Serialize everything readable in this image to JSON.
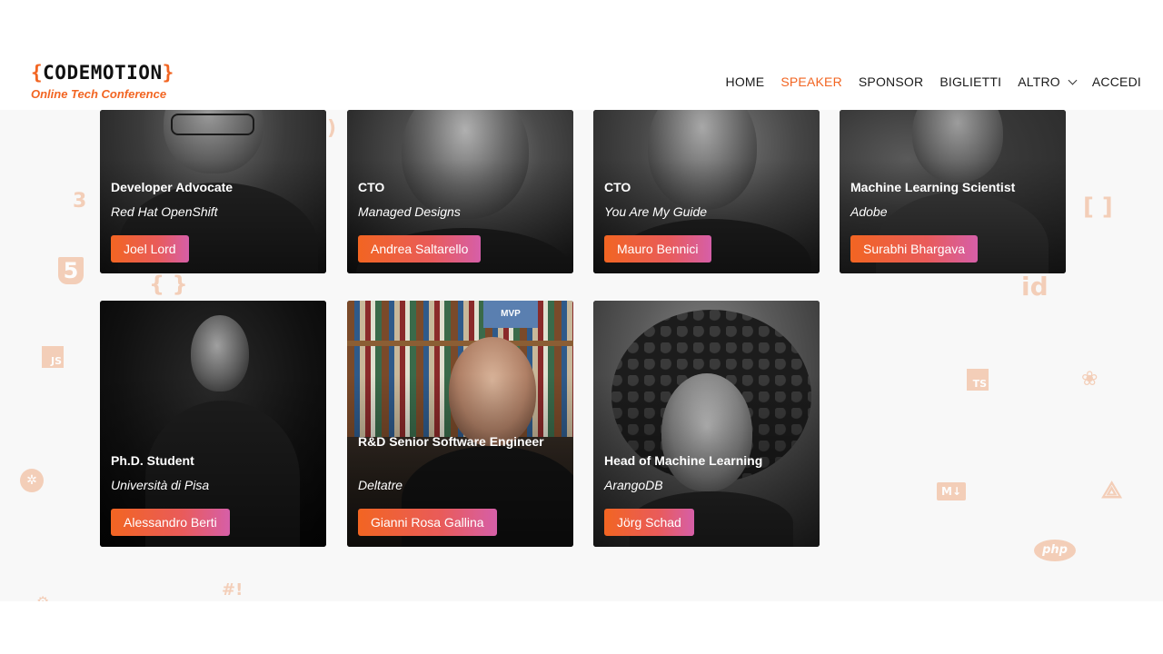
{
  "header": {
    "logo_open_brace": "{",
    "logo_word": "CODEMOTION",
    "logo_close_brace": "}",
    "logo_tagline": "Online Tech Conference",
    "nav": {
      "home": "HOME",
      "speaker": "SPEAKER",
      "sponsor": "SPONSOR",
      "biglietti": "BIGLIETTI",
      "altro": "ALTRO",
      "accedi": "ACCEDI"
    },
    "active_nav": "SPEAKER",
    "accent_color": "#f26522"
  },
  "speakers": [
    {
      "role": "Developer Advocate",
      "company": "Red Hat OpenShift",
      "name": "Joel Lord"
    },
    {
      "role": "CTO",
      "company": "Managed Designs",
      "name": "Andrea Saltarello"
    },
    {
      "role": "CTO",
      "company": "You Are My Guide",
      "name": "Mauro Bennici"
    },
    {
      "role": "Machine Learning Scientist",
      "company": "Adobe",
      "name": "Surabhi Bhargava"
    },
    {
      "role": "Ph.D. Student",
      "company": "Università di Pisa",
      "name": "Alessandro Berti"
    },
    {
      "role": "R&D Senior Software Engineer",
      "company": "Deltatre",
      "name": "Gianni Rosa Gallina"
    },
    {
      "role": "Head of Machine Learning",
      "company": "ArangoDB",
      "name": "Jörg Schad"
    }
  ],
  "background_icons": [
    "css3-icon",
    "html5-icon",
    "braces-icon",
    "js-icon",
    "kubernetes-icon",
    "shebang-icon",
    "brackets-icon",
    "id-icon",
    "ts-icon",
    "python-icon",
    "markdown-icon",
    "nuxt-icon",
    "php-icon"
  ],
  "background_icon_text": {
    "css": "3",
    "html": "5",
    "braces": "{ }",
    "js": "JS",
    "shebang": "#!",
    "brackets": "[ ]",
    "id": "id",
    "ts": "TS",
    "md": "M↓",
    "php": "php"
  }
}
